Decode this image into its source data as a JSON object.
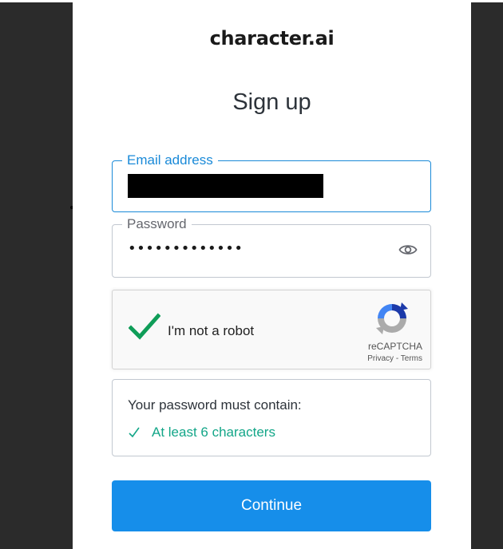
{
  "brand": {
    "logo_text": "character.ai"
  },
  "form": {
    "title": "Sign up",
    "email": {
      "label": "Email address",
      "value": ""
    },
    "password": {
      "label": "Password",
      "value": "•••••••••••••"
    },
    "captcha": {
      "label": "I'm not a robot",
      "brand": "reCAPTCHA",
      "privacy": "Privacy",
      "separator": " - ",
      "terms": "Terms"
    },
    "requirements": {
      "title": "Your password must contain:",
      "items": [
        "At least 6 characters"
      ]
    },
    "continue_label": "Continue"
  },
  "colors": {
    "accent": "#168eea",
    "focus_border": "#1a8ad8",
    "success": "#13a688",
    "captcha_check": "#0f9d58"
  },
  "icons": {
    "eye": "eye-icon",
    "check": "checkmark-icon",
    "recaptcha": "recaptcha-logo-icon"
  }
}
